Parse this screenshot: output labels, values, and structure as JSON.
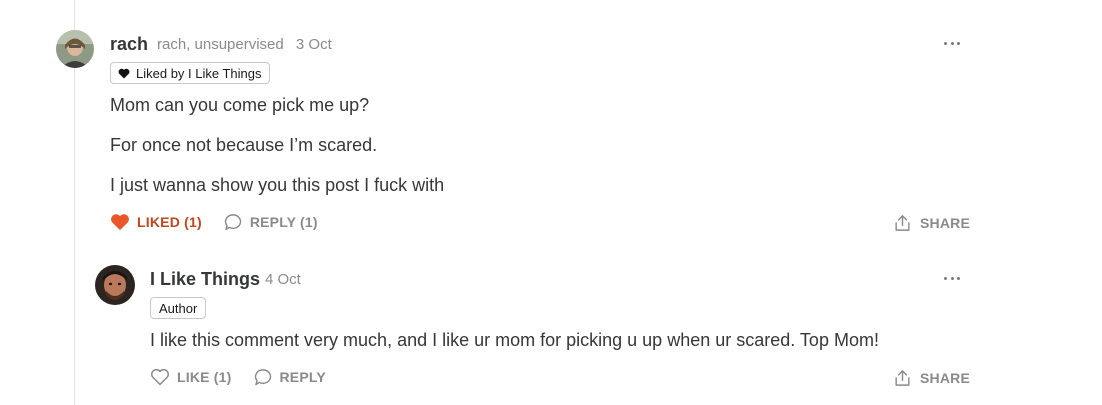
{
  "comments": [
    {
      "author": "rach",
      "handle": "rach, unsupervised",
      "date": "3 Oct",
      "badge": "Liked by I Like Things",
      "paragraphs": [
        "Mom can you come pick me up?",
        "For once not because I’m scared.",
        "I just wanna show you this post I fuck with"
      ],
      "like_label": "LIKED (1)",
      "reply_label": "REPLY (1)",
      "share_label": "SHARE",
      "liked": true,
      "accent_color": "#c4461b"
    },
    {
      "author": "I Like Things",
      "date": "4 Oct",
      "badge": "Author",
      "paragraphs": [
        "I like this comment very much, and I like ur mom for picking u up when ur scared. Top Mom!"
      ],
      "like_label": "LIKE (1)",
      "reply_label": "REPLY",
      "share_label": "SHARE",
      "liked": false
    }
  ],
  "icons": {
    "more": "ellipsis-icon",
    "heart": "heart-icon",
    "reply": "speech-bubble-icon",
    "share": "share-icon"
  }
}
